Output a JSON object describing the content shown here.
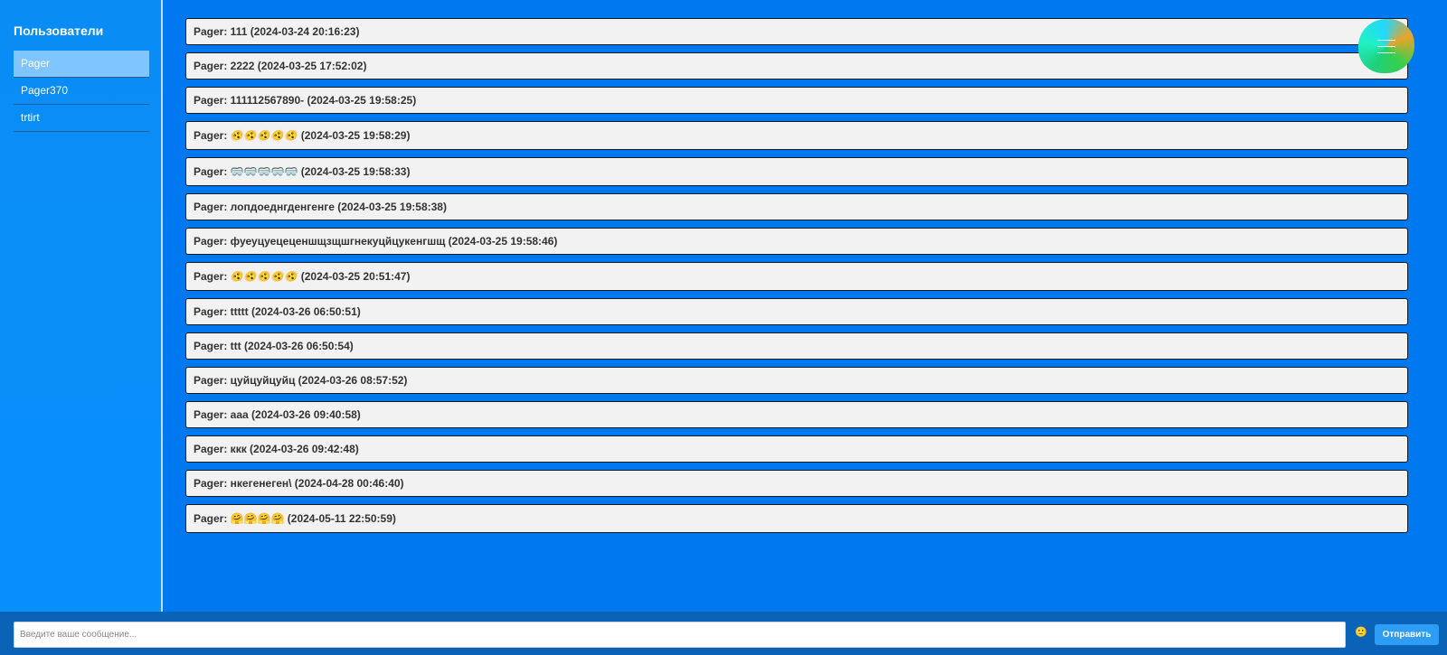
{
  "sidebar": {
    "title": "Пользователи",
    "users": [
      {
        "name": "Pager",
        "active": true
      },
      {
        "name": "Pager370",
        "active": false
      },
      {
        "name": "trtirt",
        "active": false
      }
    ]
  },
  "messages": [
    {
      "text": "Pager: 111 (2024-03-24 20:16:23)"
    },
    {
      "text": "Pager: 2222 (2024-03-25 17:52:02)"
    },
    {
      "text": "Pager: 111112567890- (2024-03-25 19:58:25)"
    },
    {
      "text": "Pager: 🫨🫨🫨🫨🫨 (2024-03-25 19:58:29)"
    },
    {
      "text": "Pager: 🥽🥽🥽🥽🥽 (2024-03-25 19:58:33)"
    },
    {
      "text": "Pager: лопдоеднгденгенге (2024-03-25 19:58:38)"
    },
    {
      "text": "Pager: фуеуцуецеценшщзщшгнекуцйцукенгшщ (2024-03-25 19:58:46)"
    },
    {
      "text": "Pager: 🫨🫨🫨🫨🫨 (2024-03-25 20:51:47)"
    },
    {
      "text": "Pager: ttttt (2024-03-26 06:50:51)"
    },
    {
      "text": "Pager: ttt (2024-03-26 06:50:54)"
    },
    {
      "text": "Pager: цуйцуйцуйц (2024-03-26 08:57:52)"
    },
    {
      "text": "Pager: ааа (2024-03-26 09:40:58)"
    },
    {
      "text": "Pager: ккк (2024-03-26 09:42:48)"
    },
    {
      "text": "Pager: нкегенеген\\ (2024-04-28 00:46:40)"
    },
    {
      "text": "Pager: 🤗🤗🤗🤗 (2024-05-11 22:50:59)"
    }
  ],
  "composer": {
    "placeholder": "Введите ваше сообщение...",
    "emoji_icon": "🙂",
    "send_label": "Отправить"
  },
  "colors": {
    "background": "#0078f0",
    "sidebar": "#0a8cf5",
    "active_user": "#7fc5ff",
    "message_bg": "#f2f2f2",
    "send_button": "#2d9df6"
  },
  "icons": {
    "menu": "hamburger-menu-icon",
    "emoji": "smiley-icon"
  }
}
